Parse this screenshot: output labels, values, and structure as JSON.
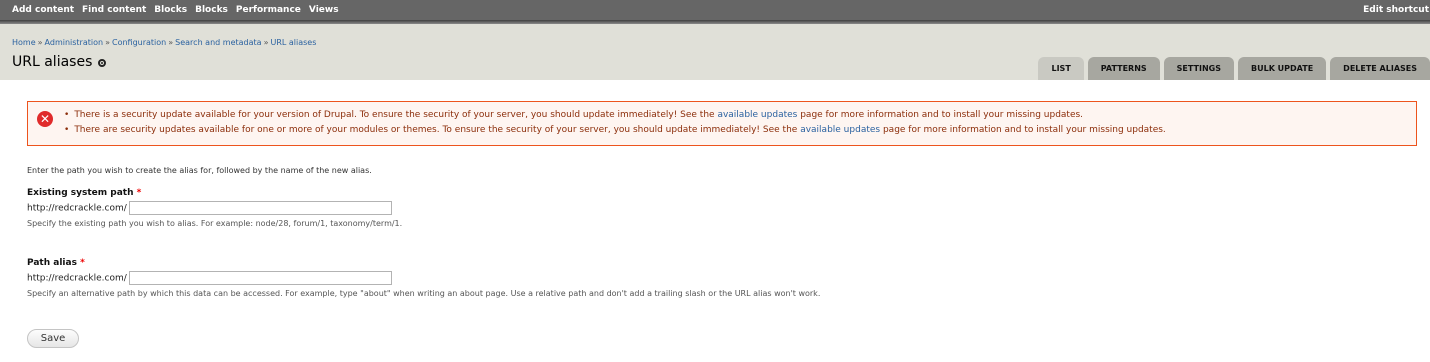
{
  "toolbar": {
    "items": [
      "Add content",
      "Find content",
      "Blocks",
      "Blocks",
      "Performance",
      "Views"
    ],
    "edit_shortcuts": "Edit shortcut"
  },
  "breadcrumb": {
    "items": [
      "Home",
      "Administration",
      "Configuration",
      "Search and metadata",
      "URL aliases"
    ],
    "separator": "»"
  },
  "page_title": "URL aliases",
  "tabs": [
    "LIST",
    "PATTERNS",
    "SETTINGS",
    "BULK UPDATE",
    "DELETE ALIASES"
  ],
  "messages": {
    "msg1_pre": "There is a security update available for your version of Drupal. To ensure the security of your server, you should update immediately! See the",
    "msg1_link": "available updates",
    "msg1_post": "page for more information and to install your missing updates.",
    "msg2_pre": "There are security updates available for one or more of your modules or themes. To ensure the security of your server, you should update immediately! See the",
    "msg2_link": "available updates",
    "msg2_post": "page for more information and to install your missing updates.",
    "icon_color": "#e02b2b"
  },
  "form": {
    "intro": "Enter the path you wish to create the alias for, followed by the name of the new alias.",
    "existing": {
      "label": "Existing system path",
      "required": "*",
      "prefix": "http://redcrackle.com/",
      "value": "",
      "description": "Specify the existing path you wish to alias. For example: node/28, forum/1, taxonomy/term/1."
    },
    "alias": {
      "label": "Path alias",
      "required": "*",
      "prefix": "http://redcrackle.com/",
      "value": "",
      "description": "Specify an alternative path by which this data can be accessed. For example, type \"about\" when writing an about page. Use a relative path and don't add a trailing slash or the URL alias won't work."
    },
    "save_label": "Save"
  }
}
